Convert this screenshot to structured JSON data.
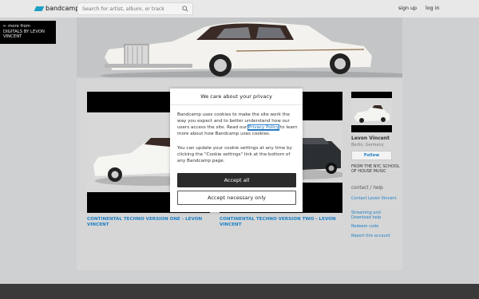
{
  "header": {
    "logo_text": "bandcamp",
    "search_placeholder": "Search for artist, album, or track",
    "signup": "sign up",
    "login": "log in"
  },
  "back_link": {
    "line1": "← more from",
    "line2": "DIGITALS BY LEVON",
    "line3": "VINCENT"
  },
  "releases": [
    {
      "title": "CONTINENTAL TECHNO VERSION ONE - LEVON VINCENT"
    },
    {
      "title": "CONTINENTAL TECHNO VERSION TWO - LEVON VINCENT"
    }
  ],
  "artist": {
    "name": "Levon Vincent",
    "location": "Berlin, Germany",
    "follow_label": "Follow",
    "bio": "FROM THE NYC SCHOOL OF HOUSE MUSIC"
  },
  "contact": {
    "heading": "contact / help",
    "links": [
      "Contact Levon Vincent",
      "Streaming and Download help",
      "Redeem code",
      "Report this account"
    ]
  },
  "cookie_dialog": {
    "title": "We care about your privacy",
    "para1_before": "Bandcamp uses cookies to make the site work the way you expect and to better understand how our users access the site. Read our ",
    "privacy_link": "Privacy Policy",
    "para1_after": " to learn more about how Bandcamp uses cookies.",
    "para2": "You can update your cookie settings at any time by clicking the \"Cookie settings\" link at the bottom of any Bandcamp page.",
    "accept_all": "Accept all",
    "accept_necessary": "Accept necessary only"
  },
  "colors": {
    "brand": "#1da0c3",
    "link": "#1c7fc4",
    "accept_bg": "#2b2b2b"
  }
}
